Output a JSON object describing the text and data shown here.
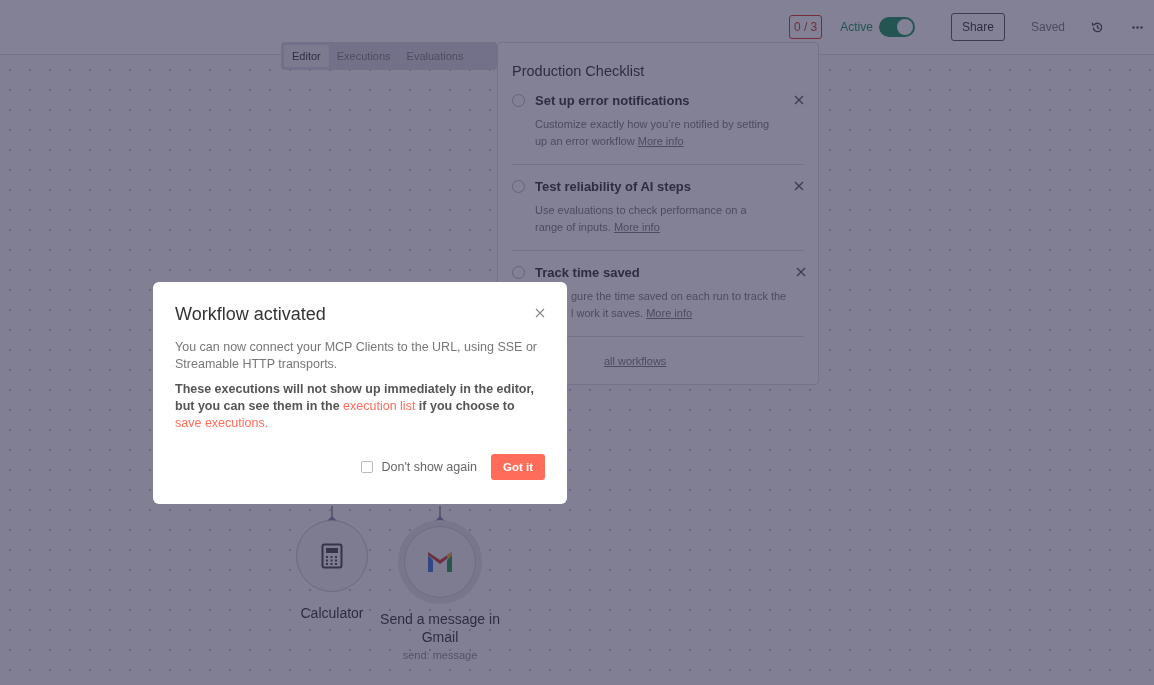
{
  "header": {
    "checklist_badge": "0 / 3",
    "active_label": "Active",
    "active_toggle": {
      "on": true
    },
    "share_button": "Share",
    "save_status": "Saved"
  },
  "tabs": [
    {
      "label": "Editor",
      "selected": true
    },
    {
      "label": "Executions",
      "selected": false
    },
    {
      "label": "Evaluations",
      "selected": false
    }
  ],
  "checklist": {
    "title": "Production Checklist",
    "items": [
      {
        "title": "Set up error notifications",
        "checked": false,
        "covered": false,
        "description_lines": [
          "Customize exactly how you’re notified by setting",
          "up an error workflow"
        ],
        "link": "More info"
      },
      {
        "title": "Test reliability of AI steps",
        "checked": false,
        "covered": false,
        "description_lines": [
          "Use evaluations to check performance on a",
          "range of inputs."
        ],
        "link": "More info"
      },
      {
        "title": "Track time saved",
        "checked": false,
        "covered": true,
        "description_lines": [
          "gure the time saved on each run to track the",
          "l work it saves."
        ],
        "link": "More info"
      }
    ],
    "footer_link": "all workflows",
    "footer_covered": true
  },
  "canvas": {
    "nodes": [
      {
        "kind": "calculator",
        "label": "Calculator"
      },
      {
        "kind": "gmail",
        "label": "Send a message in Gmail",
        "subtitle": "send: message"
      }
    ]
  },
  "dialog": {
    "title": "Workflow activated",
    "paragraphs": [
      {
        "kind": "plain",
        "parts": [
          {
            "text": "You can now connect your MCP Clients to the URL, using SSE or Streamable HTTP transports.",
            "kind": "text"
          }
        ]
      },
      {
        "kind": "strong",
        "parts": [
          {
            "text": "These executions will not show up immediately in the editor, but you can see them in the ",
            "kind": "text"
          },
          {
            "text": "execution list",
            "kind": "link"
          },
          {
            "text": " if you choose to ",
            "kind": "text"
          },
          {
            "text": "save executions.",
            "kind": "link"
          }
        ]
      }
    ],
    "dont_show_again": {
      "label": "Don't show again",
      "checked": false
    },
    "confirm_button": "Got it"
  }
}
